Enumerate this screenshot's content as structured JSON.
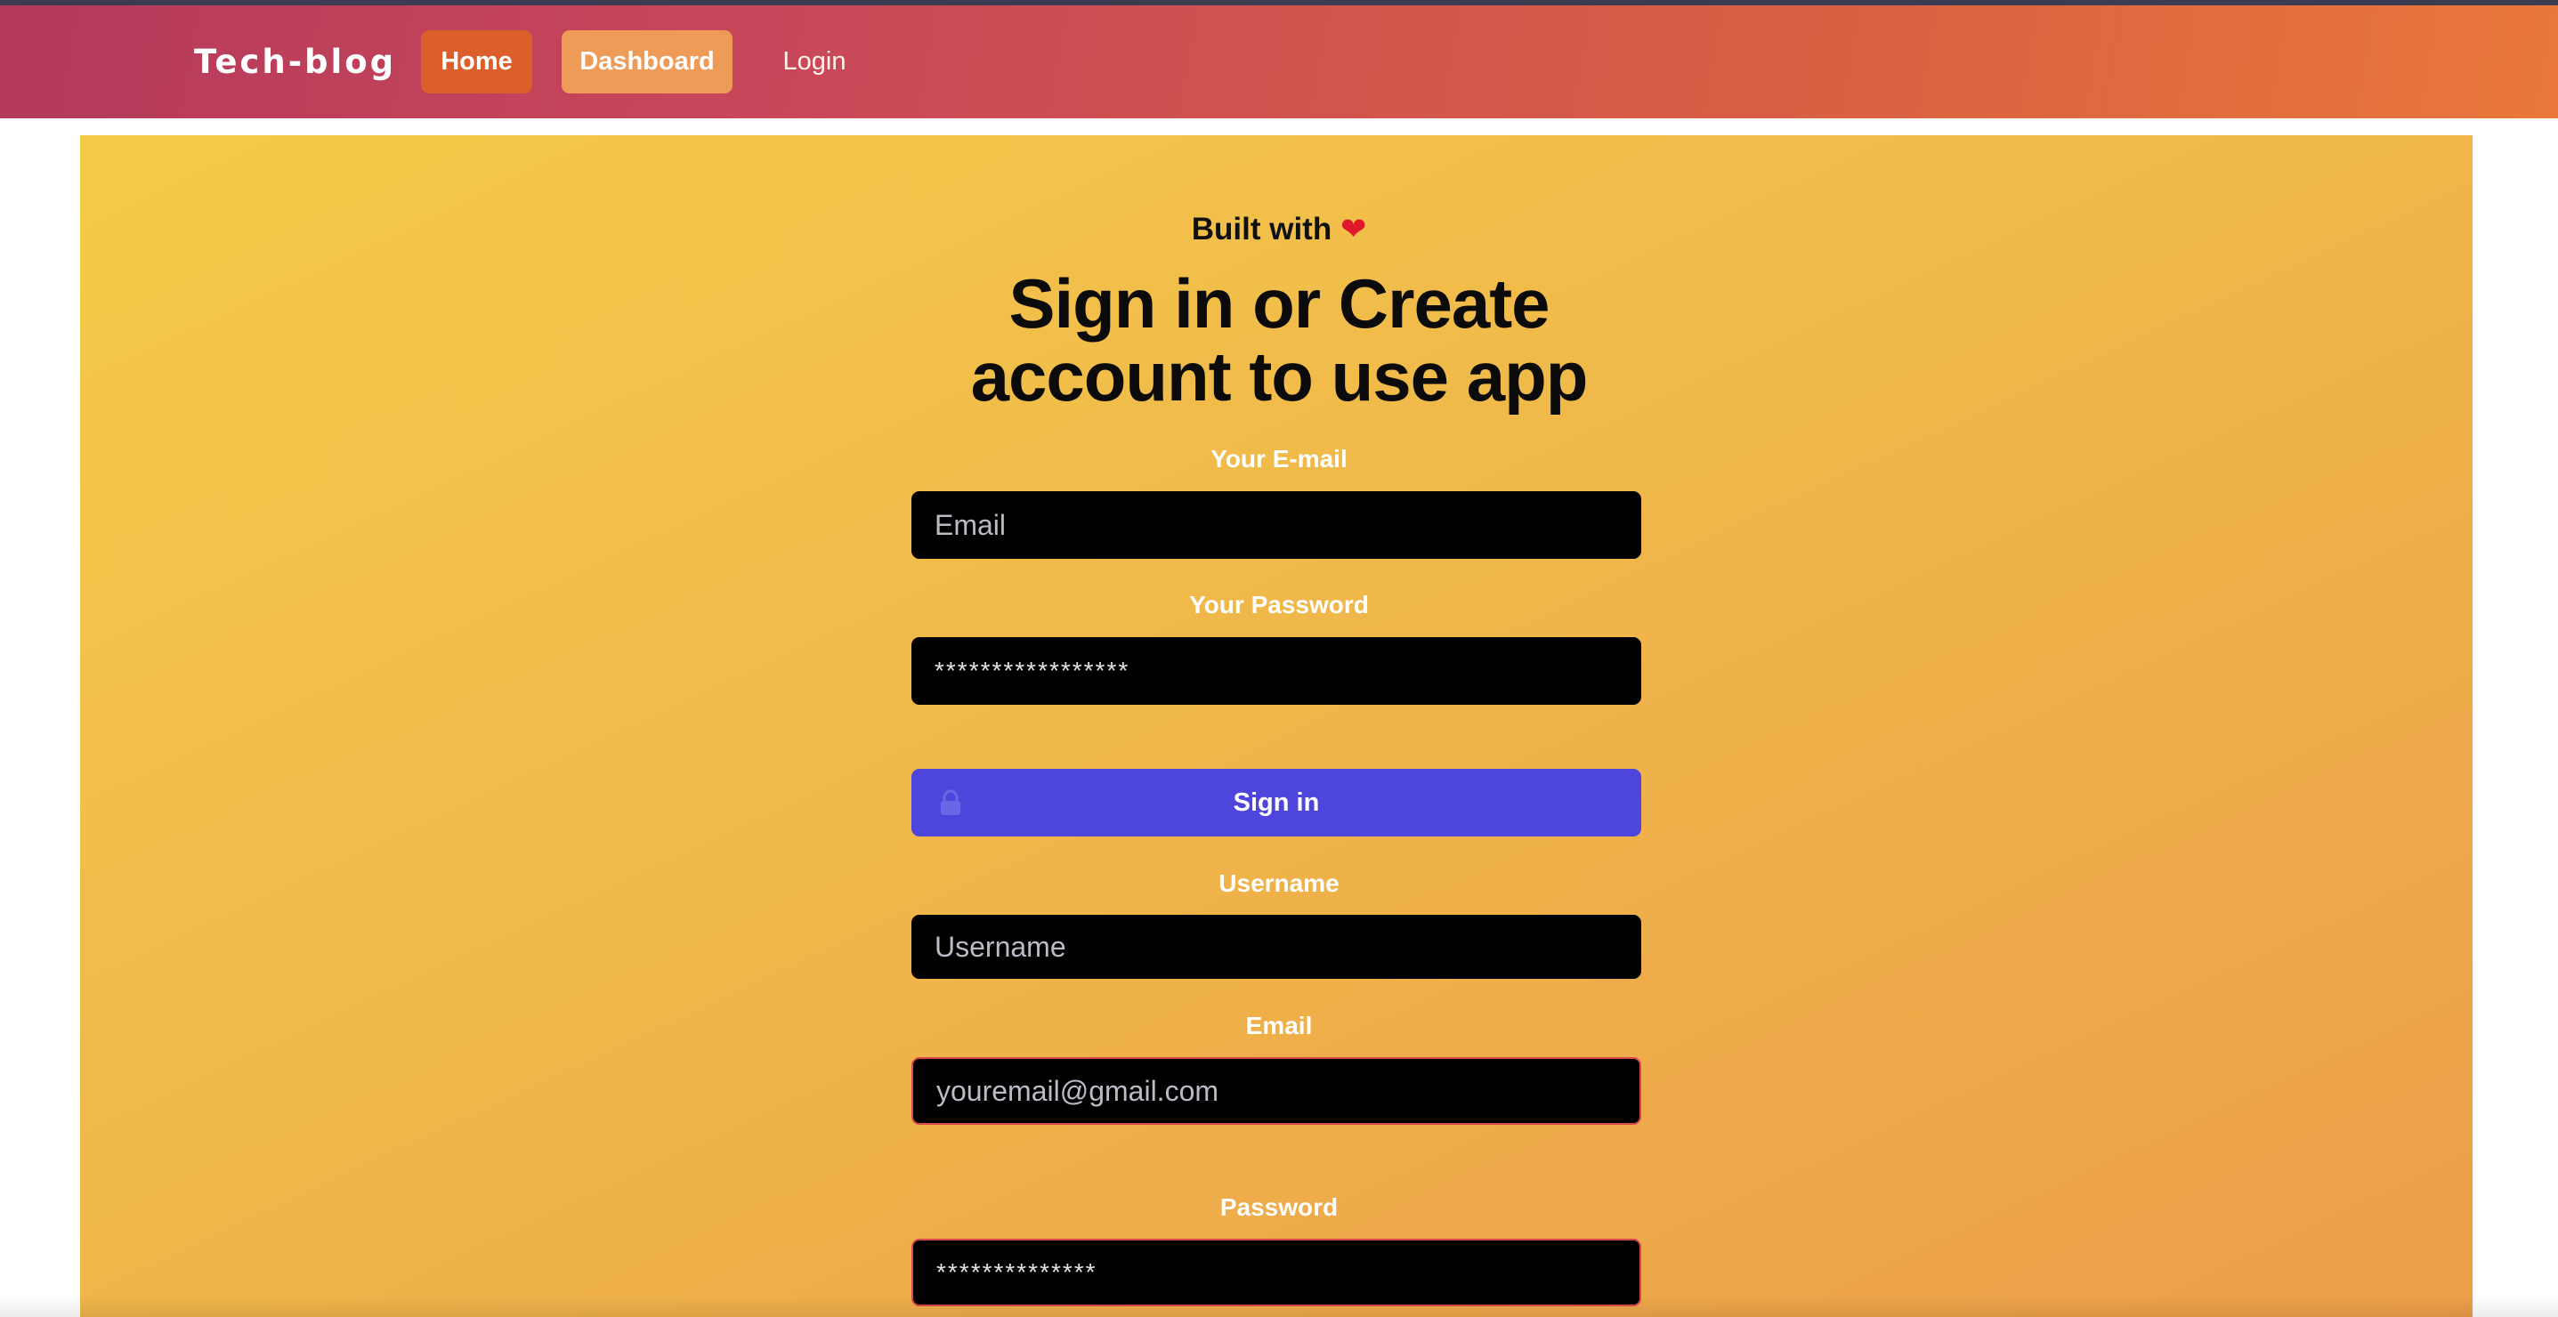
{
  "navbar": {
    "brand": "Tech-blog",
    "links": [
      {
        "label": "Home"
      },
      {
        "label": "Dashboard"
      },
      {
        "label": "Login"
      }
    ]
  },
  "hero": {
    "built_with": "Built with",
    "heart_icon": "heart-icon",
    "headline_line1": "Sign in or Create",
    "headline_line2": "account to use app"
  },
  "login_form": {
    "email_label": "Your E-mail",
    "email_placeholder": "Email",
    "password_label": "Your Password",
    "password_value": "*****************",
    "signin_label": "Sign in",
    "signin_icon": "lock-icon"
  },
  "signup_form": {
    "username_label": "Username",
    "username_placeholder": "Username",
    "email_label": "Email",
    "email_placeholder": "youremail@gmail.com",
    "password_label": "Password",
    "password_value": "**************"
  },
  "colors": {
    "navbar_start": "#b43a5b",
    "navbar_end": "#e9783a",
    "home_button": "#dc5f2b",
    "dashboard_button": "#ee9b57",
    "signin_button": "#4e46dc",
    "panel_start": "#f4cb49",
    "panel_end": "#ec9e49",
    "error_border": "#d8474a"
  }
}
